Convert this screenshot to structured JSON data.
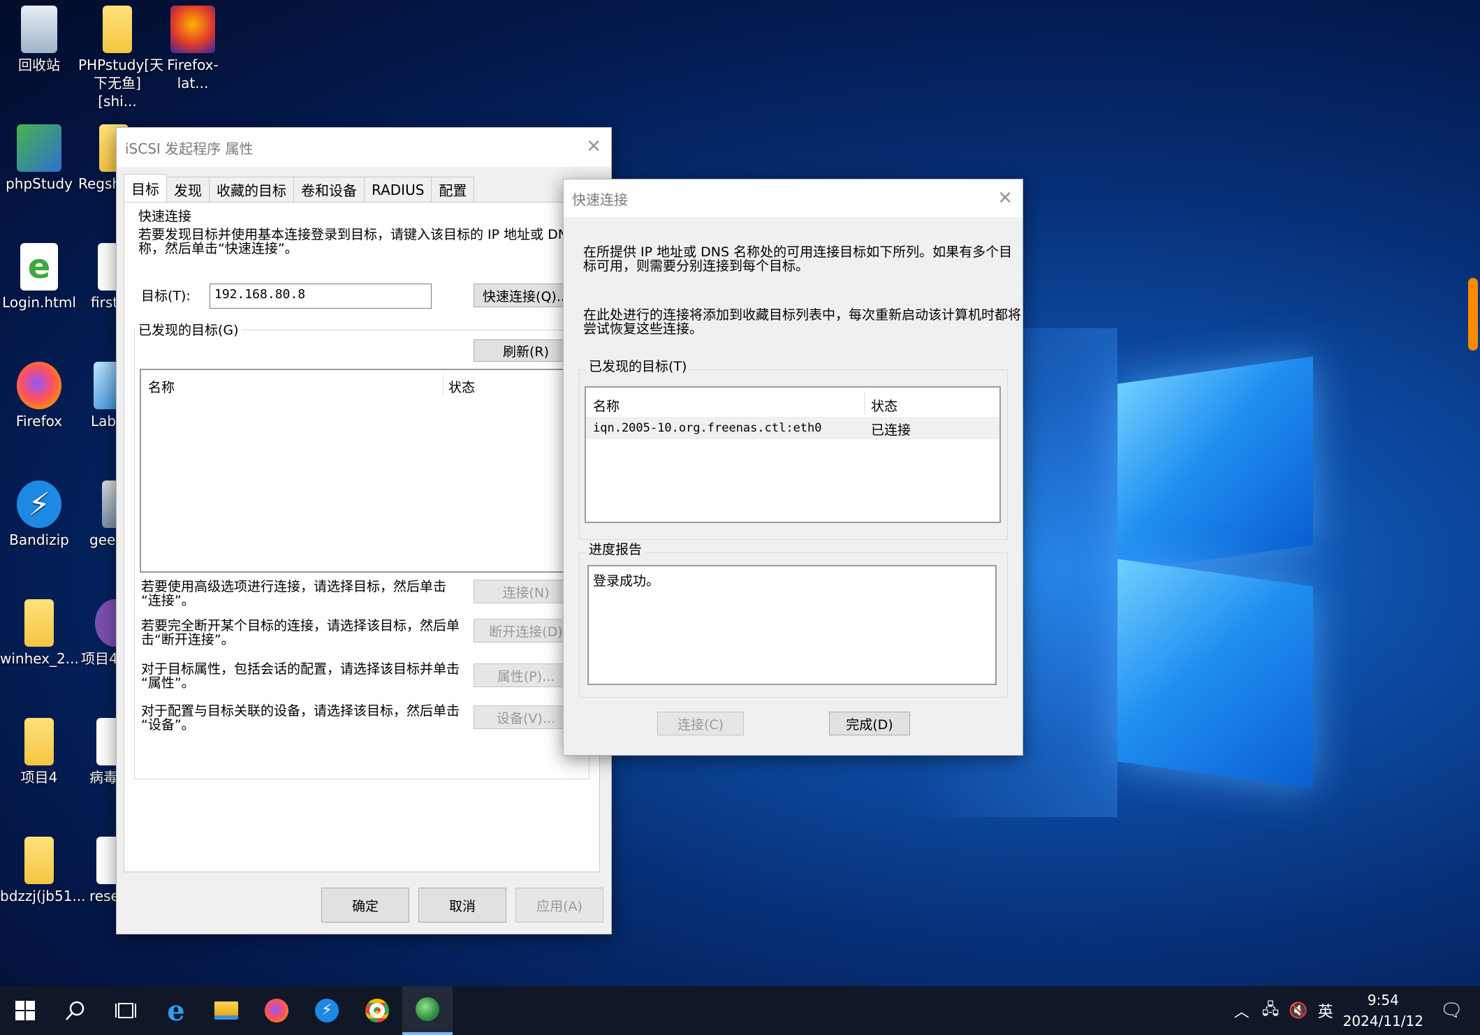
{
  "desktop": {
    "icons": [
      {
        "label": "回收站"
      },
      {
        "label": "PHPstudy[天下无鱼][shi..."
      },
      {
        "label": "Firefox-lat..."
      },
      {
        "label": "phpStudy"
      },
      {
        "label": "Regsh"
      },
      {
        "label": "Login.html"
      },
      {
        "label": "first"
      },
      {
        "label": "Firefox"
      },
      {
        "label": "Lab"
      },
      {
        "label": "Bandizip"
      },
      {
        "label": "geek"
      },
      {
        "label": "winhex_2..."
      },
      {
        "label": "项目4"
      },
      {
        "label": "项目4"
      },
      {
        "label": "病毒"
      },
      {
        "label": "bdzzj(jb51..."
      },
      {
        "label": "reset"
      }
    ]
  },
  "iscsi_dialog": {
    "title": "iSCSI 发起程序 属性",
    "tabs": [
      "目标",
      "发现",
      "收藏的目标",
      "卷和设备",
      "RADIUS",
      "配置"
    ],
    "quick_connect_group": "快速连接",
    "quick_connect_desc_1": "若要发现目标并使用基本连接登录到目标，请键入该目标的 IP 地址或 DNS 名",
    "quick_connect_desc_2": "称，然后单击“快速连接”。",
    "target_label": "目标(T):",
    "target_value": "192.168.80.8",
    "quick_connect_button": "快速连接(Q)...",
    "discovered_group": "已发现的目标(G)",
    "refresh_button": "刷新(R)",
    "col_name": "名称",
    "col_status": "状态",
    "adv_desc_1": "若要使用高级选项进行连接，请选择目标，然后单击",
    "adv_desc_2": "“连接”。",
    "connect_button": "连接(N)",
    "disc_desc_1": "若要完全断开某个目标的连接，请选择该目标，然后单",
    "disc_desc_2": "击“断开连接”。",
    "disconnect_button": "断开连接(D)",
    "prop_desc_1": "对于目标属性，包括会话的配置，请选择该目标并单击",
    "prop_desc_2": "“属性”。",
    "properties_button": "属性(P)...",
    "dev_desc_1": "对于配置与目标关联的设备，请选择该目标，然后单击",
    "dev_desc_2": "“设备”。",
    "devices_button": "设备(V)...",
    "ok_button": "确定",
    "cancel_button": "取消",
    "apply_button": "应用(A)"
  },
  "quick_dialog": {
    "title": "快速连接",
    "desc1_line1": "在所提供 IP 地址或 DNS 名称处的可用连接目标如下所列。如果有多个目",
    "desc1_line2": "标可用，则需要分别连接到每个目标。",
    "desc2_line1": "在此处进行的连接将添加到收藏目标列表中，每次重新启动该计算机时都将",
    "desc2_line2": "尝试恢复这些连接。",
    "discovered_group": "已发现的目标(T)",
    "col_name": "名称",
    "col_status": "状态",
    "rows": [
      {
        "name": "iqn.2005-10.org.freenas.ctl:eth0",
        "status": "已连接"
      }
    ],
    "progress_group": "进度报告",
    "progress_text": "登录成功。",
    "connect_button": "连接(C)",
    "done_button": "完成(D)"
  },
  "taskbar": {
    "ime": "英",
    "time": "9:54",
    "date": "2024/11/12"
  }
}
